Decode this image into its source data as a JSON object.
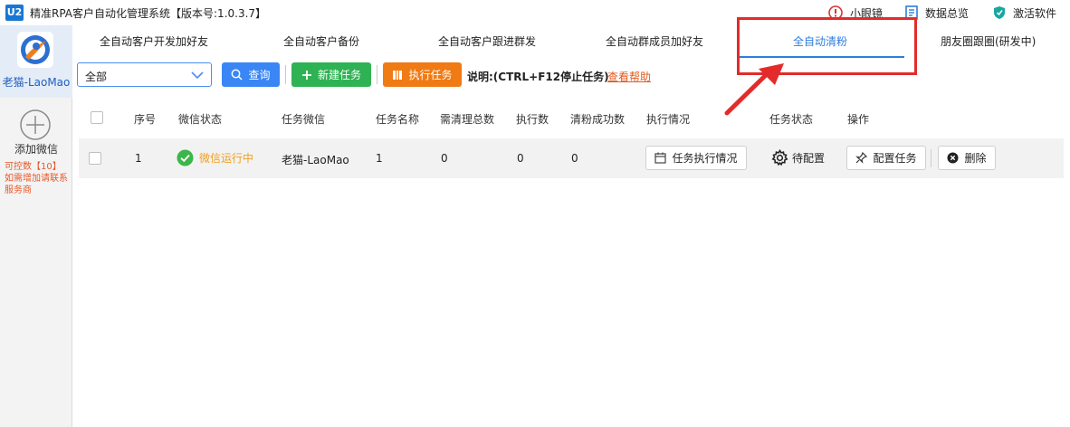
{
  "window": {
    "logo_text": "U2",
    "title": "精准RPA客户自动化管理系统【版本号:1.0.3.7】",
    "actions": [
      {
        "label": "小眼镜",
        "icon": "info-circle-icon"
      },
      {
        "label": "数据总览",
        "icon": "document-icon"
      },
      {
        "label": "激活软件",
        "icon": "shield-icon"
      }
    ]
  },
  "sidebar": {
    "account_name": "老猫-LaoMao",
    "add_label": "添加微信",
    "quota_line1": "可控数【10】",
    "quota_line2": "如需增加请联系服务商"
  },
  "tabs": [
    {
      "label": "全自动客户开发加好友",
      "active": false
    },
    {
      "label": "全自动客户备份",
      "active": false
    },
    {
      "label": "全自动客户跟进群发",
      "active": false
    },
    {
      "label": "全自动群成员加好友",
      "active": false
    },
    {
      "label": "全自动清粉",
      "active": true
    },
    {
      "label": "朋友圈跟圈(研发中)",
      "active": false
    }
  ],
  "toolbar": {
    "filter_value": "全部",
    "query_label": "查询",
    "new_task_label": "新建任务",
    "exec_task_label": "执行任务",
    "note": "说明:(CTRL+F12停止任务)",
    "help_link": "查看帮助"
  },
  "table": {
    "headers": [
      "序号",
      "微信状态",
      "任务微信",
      "任务名称",
      "需清理总数",
      "执行数",
      "清粉成功数",
      "执行情况",
      "任务状态",
      "操作"
    ],
    "rows": [
      {
        "index": "1",
        "wechat_status": "微信运行中",
        "task_wechat": "老猫-LaoMao",
        "task_name": "1",
        "total_to_clean": "0",
        "executed": "0",
        "success": "0",
        "exec_detail_label": "任务执行情况",
        "task_state": "待配置",
        "config_label": "配置任务",
        "delete_label": "删除"
      }
    ]
  },
  "colors": {
    "accent": "#2f7ddc",
    "query": "#3a86f5",
    "new_task": "#2fb253",
    "exec_task": "#f07a14",
    "highlight": "#e32b2b",
    "status_running": "#f0a020"
  }
}
